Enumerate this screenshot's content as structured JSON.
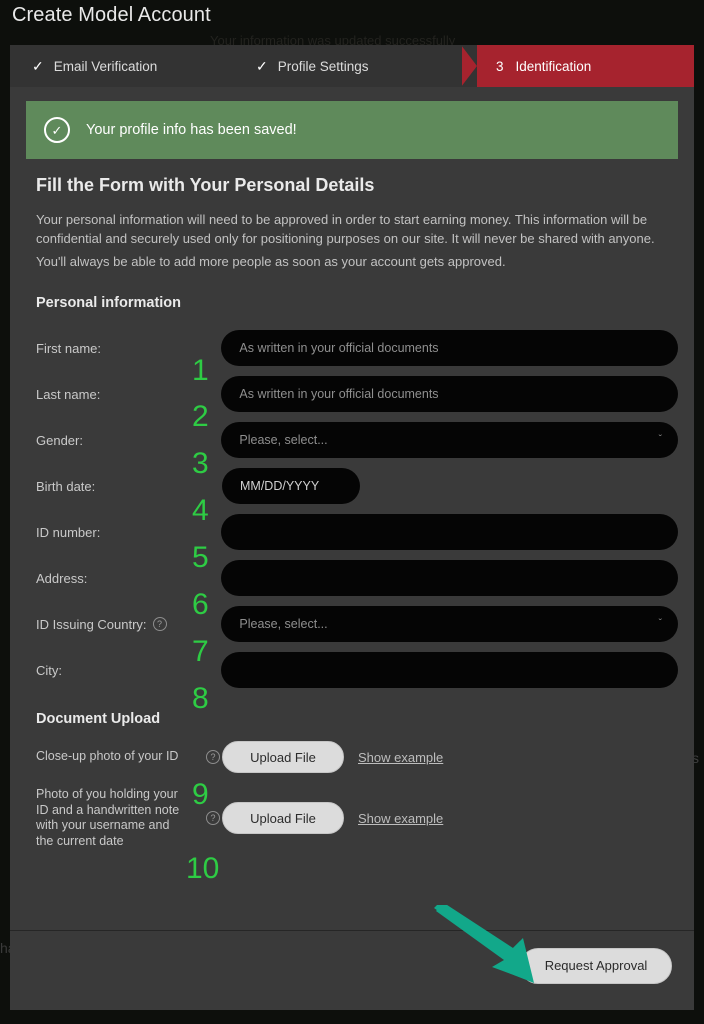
{
  "window": {
    "title": "Create Model Account"
  },
  "background_text": {
    "top_ghost": "Your information was updated successfully",
    "right_ghost": "s",
    "left_ghost": "ha"
  },
  "steps": [
    {
      "marker": "✓",
      "label": "Email Verification",
      "state": "completed"
    },
    {
      "marker": "✓",
      "label": "Profile Settings",
      "state": "completed"
    },
    {
      "marker": "3",
      "label": "Identification",
      "state": "active"
    }
  ],
  "alert": {
    "icon": "check-circle-icon",
    "glyph": "✓",
    "message": "Your profile info has been saved!",
    "color": "#5f8a5b"
  },
  "heading": "Fill the Form with Your Personal Details",
  "intro_paragraph": "Your personal information will need to be approved in order to start earning money. This information will be confidential and securely used only for positioning purposes on our site. It will never be shared with anyone.",
  "intro_paragraph_2": "You'll always be able to add more people as soon as your account gets approved.",
  "personal_section": {
    "title": "Personal information",
    "fields": [
      {
        "label": "First name:",
        "placeholder": "As written in your official documents",
        "type": "text",
        "marker": "1",
        "help": false
      },
      {
        "label": "Last name:",
        "placeholder": "As written in your official documents",
        "type": "text",
        "marker": "2",
        "help": false
      },
      {
        "label": "Gender:",
        "placeholder": "Please, select...",
        "type": "select",
        "marker": "3",
        "help": false
      },
      {
        "label": "Birth date:",
        "placeholder": "MM/DD/YYYY",
        "type": "date",
        "marker": "4",
        "help": false
      },
      {
        "label": "ID number:",
        "placeholder": "",
        "type": "text",
        "marker": "5",
        "help": false
      },
      {
        "label": "Address:",
        "placeholder": "",
        "type": "text",
        "marker": "6",
        "help": false
      },
      {
        "label": "ID Issuing Country:",
        "placeholder": "Please, select...",
        "type": "select",
        "marker": "7",
        "help": true
      },
      {
        "label": "City:",
        "placeholder": "",
        "type": "text",
        "marker": "8",
        "help": false
      }
    ]
  },
  "document_section": {
    "title": "Document Upload",
    "uploads": [
      {
        "label": "Close-up photo of your ID",
        "button": "Upload File",
        "link": "Show example",
        "marker": "9",
        "help": true
      },
      {
        "label": "Photo of you holding your ID and a handwritten note with your username and the current date",
        "button": "Upload File",
        "link": "Show example",
        "marker": "10",
        "help": true
      }
    ]
  },
  "footer": {
    "submit_label": "Request Approval"
  },
  "annotations": {
    "arrow_color": "#12a88a",
    "marker_color": "#2ecc44"
  },
  "select_caret": "ˇ"
}
